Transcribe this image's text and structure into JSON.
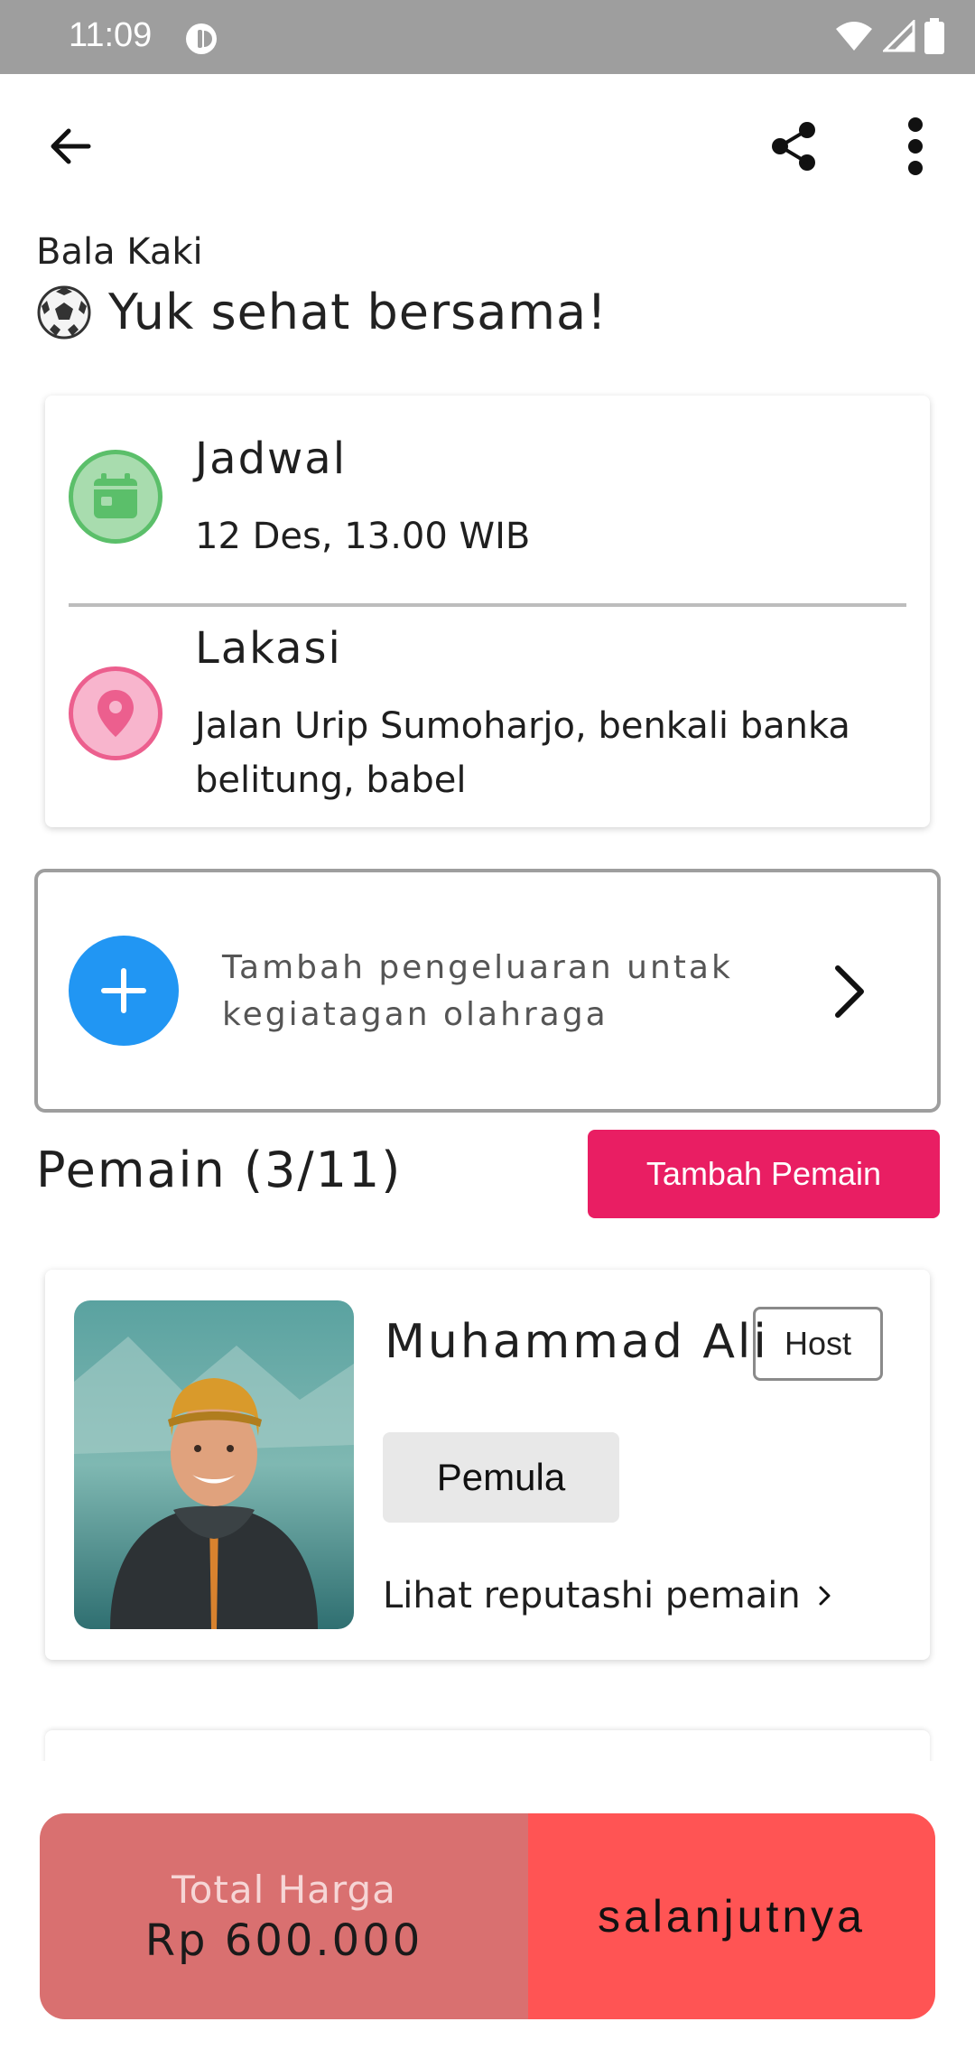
{
  "status_bar": {
    "time": "11:09",
    "icons": [
      "dnd-icon",
      "wifi-icon",
      "signal-icon",
      "battery-icon"
    ]
  },
  "toolbar": {
    "back_icon": "arrow-left-icon",
    "share_icon": "share-icon",
    "more_icon": "more-vert-icon"
  },
  "event": {
    "category": "Bala Kaki",
    "title": "Yuk sehat bersama!",
    "title_icon": "soccer-ball-icon"
  },
  "details": {
    "schedule_label": "Jadwal",
    "schedule_value": "12 Des, 13.00 WIB",
    "location_label": "Lakasi",
    "location_value": "Jalan Urip Sumoharjo, benkali banka belitung, babel",
    "schedule_icon_color": "#5bbf6a",
    "location_icon_color": "#ec5f8e"
  },
  "expense": {
    "text": "Tambah pengeluaran untak kegiatagan olahraga",
    "icon": "plus-icon",
    "accent": "#2196f3"
  },
  "players": {
    "title": "Pemain (3/11)",
    "add_button": "Tambah Pemain",
    "add_button_color": "#e91e63",
    "list": [
      {
        "name": "Muhammad Ali",
        "badge": "Host",
        "level": "Pemula",
        "reputation_link": "Lihat reputashi pemain"
      }
    ]
  },
  "footer": {
    "total_label": "Total Harga",
    "total_value": "Rp 600.000",
    "next_button": "salanjutnya",
    "total_bg": "#d97070",
    "next_bg": "#ff5454"
  }
}
